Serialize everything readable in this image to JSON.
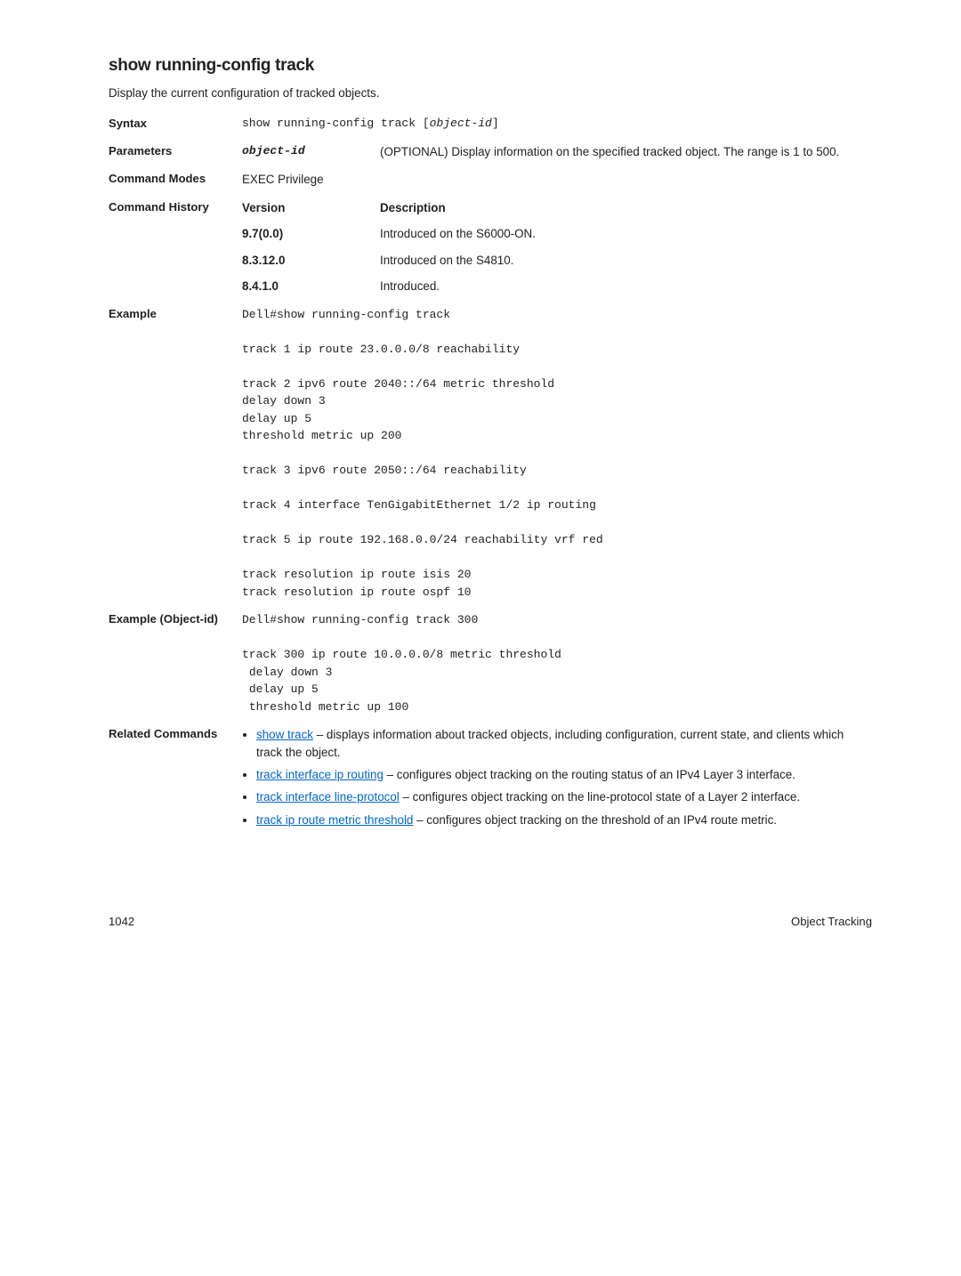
{
  "heading": "show running-config track",
  "desc": "Display the current configuration of tracked objects.",
  "syntax": {
    "label": "Syntax",
    "value": "show running-config track [",
    "emph": "object-id",
    "tail": "]"
  },
  "parameters": {
    "label": "Parameters",
    "name": "object-id",
    "text": "(OPTIONAL) Display information on the specified tracked object. The range is 1 to 500."
  },
  "modes": {
    "label": "Command Modes",
    "value": "EXEC Privilege"
  },
  "history": {
    "label": "Command History",
    "header_version": "Version",
    "header_desc": "Description",
    "rows": [
      {
        "ver": "9.7(0.0)",
        "desc": "Introduced on the S6000-ON."
      },
      {
        "ver": "8.3.12.0",
        "desc": "Introduced on the S4810."
      },
      {
        "ver": "8.4.1.0",
        "desc": "Introduced."
      }
    ]
  },
  "example": {
    "label": "Example",
    "text": "Dell#show running-config track\n\ntrack 1 ip route 23.0.0.0/8 reachability\n\ntrack 2 ipv6 route 2040::/64 metric threshold\ndelay down 3\ndelay up 5\nthreshold metric up 200\n\ntrack 3 ipv6 route 2050::/64 reachability\n\ntrack 4 interface TenGigabitEthernet 1/2 ip routing\n\ntrack 5 ip route 192.168.0.0/24 reachability vrf red\n\ntrack resolution ip route isis 20\ntrack resolution ip route ospf 10"
  },
  "example_obj": {
    "label": "Example (Object-id)",
    "text": "Dell#show running-config track 300\n\ntrack 300 ip route 10.0.0.0/8 metric threshold\n delay down 3\n delay up 5\n threshold metric up 100"
  },
  "related": {
    "label": "Related Commands",
    "items": [
      {
        "link": "show track",
        "text": " – displays information about tracked objects, including configuration, current state, and clients which track the object."
      },
      {
        "link": "track interface ip routing",
        "text": " – configures object tracking on the routing status of an IPv4 Layer 3 interface."
      },
      {
        "link": "track interface line-protocol",
        "text": " – configures object tracking on the line-protocol state of a Layer 2 interface."
      },
      {
        "link": "track ip route metric threshold",
        "text": " – configures object tracking on the threshold of an IPv4 route metric."
      }
    ]
  },
  "footer": {
    "page": "1042",
    "section": "Object Tracking"
  }
}
